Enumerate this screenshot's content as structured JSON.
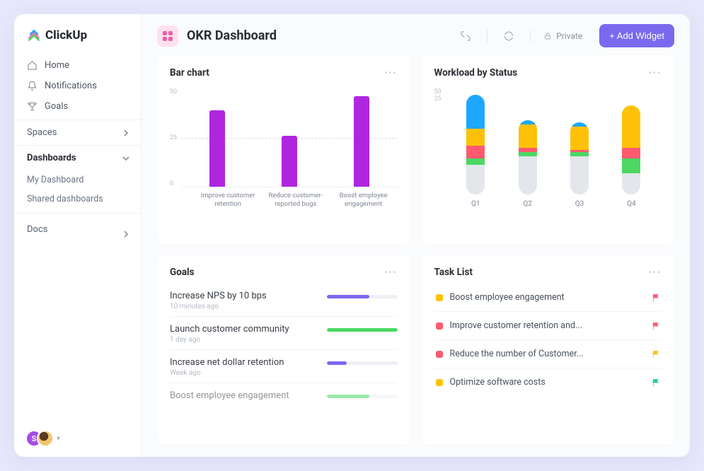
{
  "brand": {
    "name": "ClickUp"
  },
  "sidebar": {
    "nav": [
      {
        "label": "Home",
        "icon": "home"
      },
      {
        "label": "Notifications",
        "icon": "bell"
      },
      {
        "label": "Goals",
        "icon": "trophy"
      }
    ],
    "sections": {
      "spaces": {
        "label": "Spaces"
      },
      "dashboards": {
        "label": "Dashboards",
        "items": [
          {
            "label": "My Dashboard"
          },
          {
            "label": "Shared dashboards"
          }
        ]
      },
      "docs": {
        "label": "Docs"
      }
    },
    "avatar_initial": "S"
  },
  "header": {
    "title": "OKR Dashboard",
    "private_label": "Private",
    "add_widget_label": "+ Add Widget"
  },
  "cards": {
    "bar": {
      "title": "Bar chart"
    },
    "workload": {
      "title": "Workload by Status"
    },
    "goals": {
      "title": "Goals"
    },
    "tasks": {
      "title": "Task List"
    }
  },
  "goals": [
    {
      "name": "Increase NPS by 10 bps",
      "time": "10 minutes ago",
      "progress": 60,
      "color": "#7b68ee"
    },
    {
      "name": "Launch customer community",
      "time": "1 day ago",
      "progress": 100,
      "color": "#4bd762"
    },
    {
      "name": "Increase net dollar retention",
      "time": "Week ago",
      "progress": 28,
      "color": "#7b68ee"
    },
    {
      "name": "Boost employee engagement",
      "time": "",
      "progress": 60,
      "color": "#4bd762"
    }
  ],
  "tasks": [
    {
      "name": "Boost employee engagement",
      "color": "#ffc107",
      "flag": "#ff5a6e"
    },
    {
      "name": "Improve customer retention and...",
      "color": "#ff5a6e",
      "flag": "#ff5a6e"
    },
    {
      "name": "Reduce the number of Customer...",
      "color": "#ff5a6e",
      "flag": "#ffc107"
    },
    {
      "name": "Optimize software costs",
      "color": "#ffc107",
      "flag": "#18d19a"
    }
  ],
  "chart_data": [
    {
      "id": "bar",
      "type": "bar",
      "title": "Bar chart",
      "categories": [
        "Improve customer retention",
        "Reduce customer-reported bugs",
        "Boost employee engagement"
      ],
      "values": [
        39,
        26,
        46
      ],
      "ylim": [
        0,
        50
      ],
      "yticks": [
        0,
        25,
        50
      ],
      "target_line": 25,
      "bar_color": "#b026e0"
    },
    {
      "id": "workload",
      "type": "stacked-bar",
      "title": "Workload by Status",
      "categories": [
        "Q1",
        "Q2",
        "Q3",
        "Q4"
      ],
      "ylim": [
        0,
        50
      ],
      "yticks": [
        25,
        50
      ],
      "series": [
        {
          "name": "grey",
          "color": "#e3e6ea",
          "values": [
            14,
            18,
            18,
            10
          ]
        },
        {
          "name": "green",
          "color": "#4bd762",
          "values": [
            3,
            2,
            2,
            7
          ]
        },
        {
          "name": "red",
          "color": "#ff5a6e",
          "values": [
            6,
            2,
            1,
            5
          ]
        },
        {
          "name": "yellow",
          "color": "#ffc107",
          "values": [
            8,
            11,
            11,
            20
          ]
        },
        {
          "name": "blue",
          "color": "#1ea7ff",
          "values": [
            16,
            2,
            2,
            0
          ]
        }
      ]
    }
  ]
}
